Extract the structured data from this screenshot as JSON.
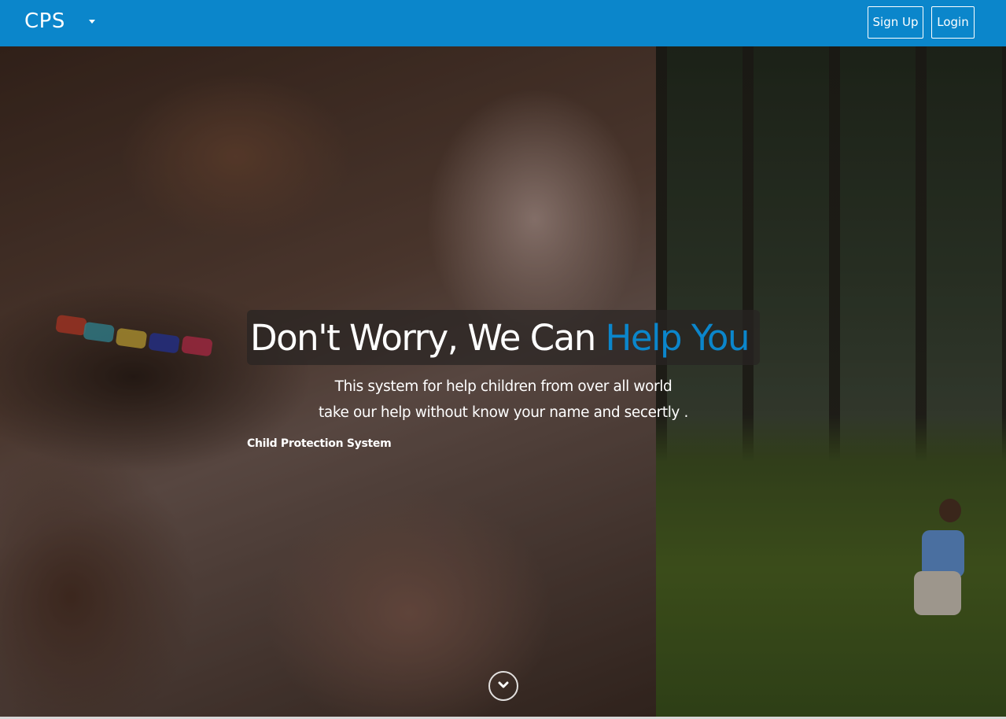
{
  "navbar": {
    "brand": "CPS",
    "signup_label": "Sign Up",
    "login_label": "Login",
    "background_color": "#0b86cb"
  },
  "hero": {
    "headline_main": "Don't Worry, We Can ",
    "headline_accent": "Help You",
    "accent_color": "#0b86cb",
    "subtext_line1": "This system for help children from over all world",
    "subtext_line2": "take our help without know your name and secertly .",
    "tagline": "Child Protection System",
    "scroll_icon": "chevron-down-circle-icon"
  }
}
